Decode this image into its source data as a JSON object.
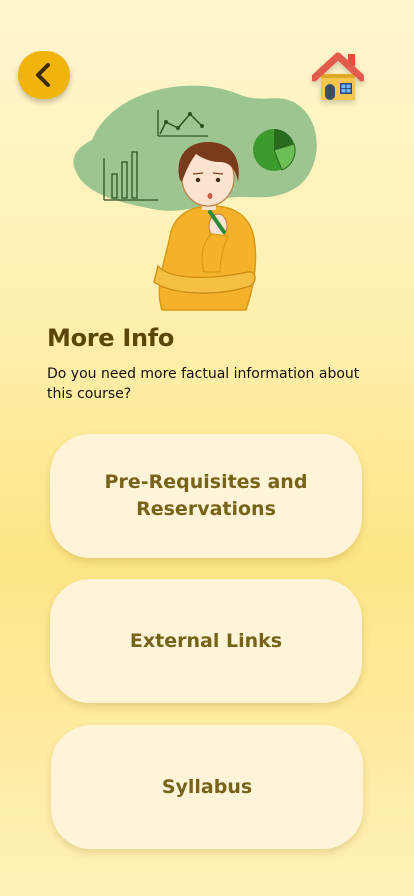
{
  "header": {
    "back_icon": "chevron-left-icon",
    "home_icon": "house-emoji-icon"
  },
  "main": {
    "title": "More Info",
    "subtitle": "Do you need more factual information about this course?"
  },
  "options": [
    {
      "label": "Pre-Requisites and Reservations"
    },
    {
      "label": "External Links"
    },
    {
      "label": "Syllabus"
    }
  ],
  "colors": {
    "accent": "#f1b40b",
    "title": "#5a4608",
    "option_text": "#776219",
    "option_bg": "#fff4d8"
  }
}
